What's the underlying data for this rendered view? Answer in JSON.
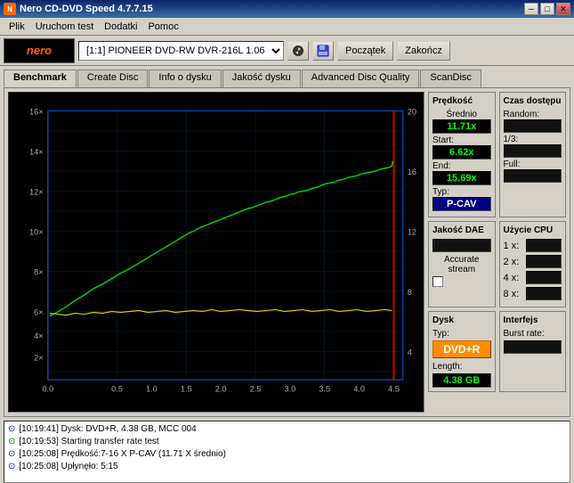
{
  "window": {
    "title": "Nero CD-DVD Speed 4.7.7.15",
    "min_btn": "─",
    "max_btn": "□",
    "close_btn": "✕"
  },
  "menu": {
    "items": [
      "Plik",
      "Uruchom test",
      "Dodatki",
      "Pomoc"
    ]
  },
  "toolbar": {
    "drive_value": "[1:1]  PIONEER DVD-RW  DVR-216L 1.06",
    "start_btn": "Początek",
    "end_btn": "Zakończ"
  },
  "tabs": [
    {
      "label": "Benchmark",
      "active": true
    },
    {
      "label": "Create Disc",
      "active": false
    },
    {
      "label": "Info o dysku",
      "active": false
    },
    {
      "label": "Jakość dysku",
      "active": false
    },
    {
      "label": "Advanced Disc Quality",
      "active": false
    },
    {
      "label": "ScanDisc",
      "active": false
    }
  ],
  "speed_panel": {
    "title": "Prędkość",
    "avg_label": "Średnio",
    "avg_value": "11.71x",
    "start_label": "Start:",
    "start_value": "6.62x",
    "end_label": "End:",
    "end_value": "15.69x",
    "type_label": "Typ:",
    "type_value": "P-CAV"
  },
  "access_panel": {
    "title": "Czas dostępu",
    "random_label": "Random:",
    "random_value": "",
    "third_label": "1/3:",
    "third_value": "",
    "full_label": "Full:",
    "full_value": ""
  },
  "dae_panel": {
    "title": "Jakość DAE",
    "accurate_label": "Accurate",
    "stream_label": "stream"
  },
  "cpu_panel": {
    "title": "Użycie CPU",
    "1x_label": "1 x:",
    "1x_value": "",
    "2x_label": "2 x:",
    "2x_value": "",
    "4x_label": "4 x:",
    "4x_value": "",
    "8x_label": "8 x:",
    "8x_value": ""
  },
  "disc_panel": {
    "title": "Dysk",
    "type_label": "Typ:",
    "type_value": "DVD+R",
    "length_label": "Length:",
    "length_value": "4.38 GB"
  },
  "interface_panel": {
    "title": "Interfejs",
    "burst_label": "Burst rate:",
    "burst_value": ""
  },
  "log": {
    "lines": [
      {
        "icon": "◎",
        "icon_type": "blue",
        "text": "[10:19:41]  Dysk: DVD+R, 4.38 GB, MCC 004"
      },
      {
        "icon": "◎",
        "icon_type": "green",
        "text": "[10:19:53]  Starting transfer rate test"
      },
      {
        "icon": "◎",
        "icon_type": "blue",
        "text": "[10:25:08]  Prędkość:7-16 X P-CAV (11.71 X średnio)"
      },
      {
        "icon": "◎",
        "icon_type": "blue",
        "text": "[10:25:08]  Upłynęło: 5:15"
      }
    ]
  }
}
